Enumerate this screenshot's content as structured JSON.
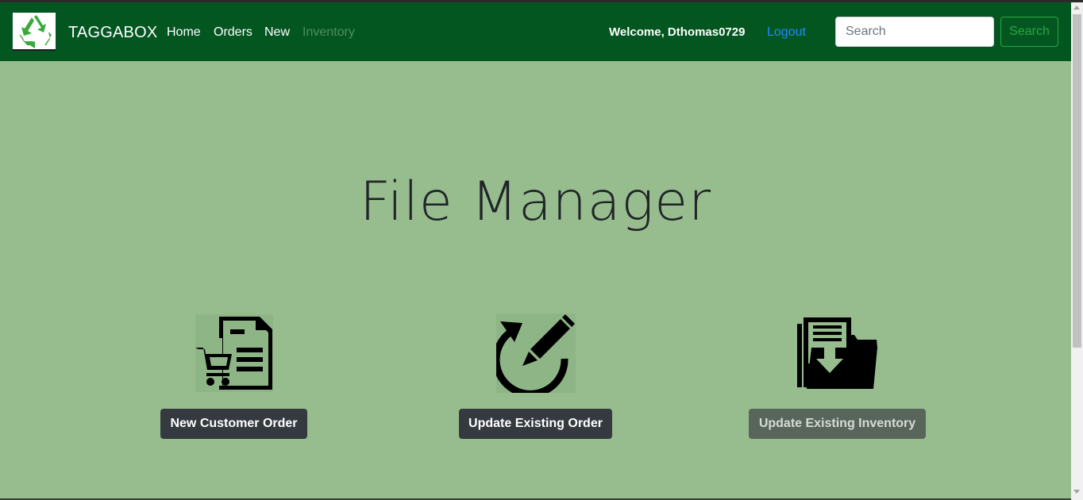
{
  "navbar": {
    "brand": "TAGGABOX",
    "logo_icon": "recycle-icon",
    "links": [
      {
        "label": "Home",
        "disabled": false
      },
      {
        "label": "Orders",
        "disabled": false
      },
      {
        "label": "New",
        "disabled": false
      },
      {
        "label": "Inventory",
        "disabled": true
      }
    ],
    "welcome_text": "Welcome, Dthomas0729",
    "logout_label": "Logout",
    "search_placeholder": "Search",
    "search_button_label": "Search"
  },
  "main": {
    "title": "File Manager",
    "cards": [
      {
        "icon": "shopping-cart-document-icon",
        "button_label": "New Customer Order",
        "disabled": false
      },
      {
        "icon": "edit-refresh-icon",
        "button_label": "Update Existing Order",
        "disabled": false
      },
      {
        "icon": "folder-download-icon",
        "button_label": "Update Existing Inventory",
        "disabled": true
      }
    ]
  },
  "colors": {
    "navbar_bg": "#045620",
    "page_bg": "#97bd8e",
    "link_blue": "#1e8bff",
    "search_green": "#28a745",
    "button_dark": "#343a40",
    "logo_green": "#3aa83a"
  }
}
